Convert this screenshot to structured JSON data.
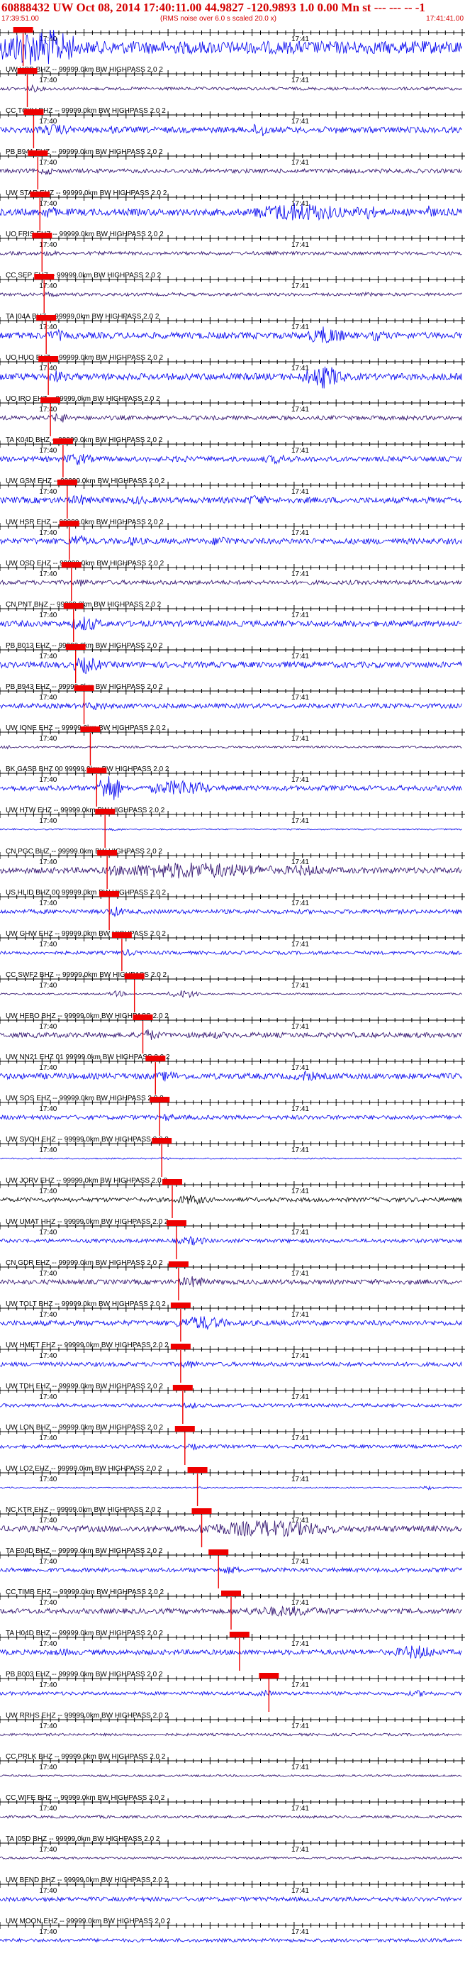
{
  "header": {
    "title": "60888432 UW Oct 08, 2014 17:40:11.00   44.9827 -120.9893  1.0 0.00 Mn st --- --- --   -1",
    "start_time": "17:39:51.00",
    "note": "(RMS noise over 6.0 s scaled 20.0 x)",
    "end_time": "17:41:41.00"
  },
  "chart_data": {
    "type": "line",
    "title": "60888432 UW Oct 08, 2014 17:40:11.00   44.9827 -120.9893  1.0 0.00 Mn st --- --- --   -1",
    "x_range_seconds": [
      0,
      110
    ],
    "tick_labels": [
      {
        "label": "17:40",
        "t": 9
      },
      {
        "label": "17:41",
        "t": 69
      }
    ],
    "colors": {
      "trace_blue": "#0000ee",
      "trace_dark": "#2a0a6a",
      "trace_black": "#000000",
      "pick": "#ee0000"
    },
    "channels": [
      {
        "label": "",
        "pick_t": 5.5,
        "amp": 0.75,
        "color": "#0000ee",
        "bursts": [
          [
            0,
            18,
            3.5
          ]
        ]
      },
      {
        "label": "UW YCB BHZ -- 99999.0km BW  HIGHPASS  2.0  2",
        "pick_t": 6.5,
        "amp": 0.18,
        "color": "#2a0a6a",
        "bursts": [
          [
            6,
            10,
            2.5
          ]
        ]
      },
      {
        "label": "CC TCKV BHZ -- 99999.0km BW  HIGHPASS  2.0  2",
        "pick_t": 8,
        "amp": 0.35,
        "color": "#0000ee",
        "bursts": [
          [
            8,
            18,
            2
          ],
          [
            24,
            30,
            1.5
          ],
          [
            60,
            64,
            3
          ],
          [
            78,
            82,
            1.5
          ]
        ]
      },
      {
        "label": "PB B941 EHZ -- 99999.0km BW  HIGHPASS  2.0  2",
        "pick_t": 9,
        "amp": 0.25,
        "color": "#2a0a6a",
        "bursts": [
          [
            9,
            13,
            2
          ],
          [
            50,
            55,
            1.3
          ]
        ]
      },
      {
        "label": "UW STAR EHZ -- 99999.0km BW  HIGHPASS  2.0  2",
        "pick_t": 9.5,
        "amp": 0.4,
        "color": "#0000ee",
        "bursts": [
          [
            9,
            14,
            2
          ],
          [
            60,
            82,
            3
          ],
          [
            84,
            90,
            2.5
          ],
          [
            100,
            104,
            2
          ]
        ]
      },
      {
        "label": "UO FRIS EHZ -- 99999.0km BW  HIGHPASS  2.0  2",
        "pick_t": 10,
        "amp": 0.2,
        "color": "#2a0a6a",
        "bursts": [
          [
            10,
            14,
            2
          ]
        ]
      },
      {
        "label": "CC SEP EHZ -- 99999.0km BW  HIGHPASS  2.0  2",
        "pick_t": 10.5,
        "amp": 0.18,
        "color": "#2a0a6a",
        "bursts": [
          [
            10,
            14,
            2
          ],
          [
            40,
            44,
            1.5
          ],
          [
            85,
            90,
            1.5
          ]
        ]
      },
      {
        "label": "TA I04A BHZ -- 99999.0km BW  HIGHPASS  2.0  2",
        "pick_t": 11,
        "amp": 0.38,
        "color": "#0000ee",
        "bursts": [
          [
            11,
            16,
            2
          ],
          [
            73,
            82,
            3
          ],
          [
            88,
            92,
            2
          ]
        ]
      },
      {
        "label": "UO HUO EHZ -- 99999.0km BW  HIGHPASS  2.0  2",
        "pick_t": 11.5,
        "amp": 0.4,
        "color": "#0000ee",
        "bursts": [
          [
            11,
            16,
            2
          ],
          [
            72,
            82,
            3.5
          ]
        ]
      },
      {
        "label": "UO IRO EHZ -- 99999.0km BW  HIGHPASS  2.0  2",
        "pick_t": 12,
        "amp": 0.25,
        "color": "#2a0a6a",
        "bursts": [
          [
            12,
            17,
            2.5
          ]
        ]
      },
      {
        "label": "TA K04D BHZ -- 99999.0km BW  HIGHPASS  2.0  2",
        "pick_t": 15,
        "amp": 0.3,
        "color": "#0000ee",
        "bursts": [
          [
            15,
            22,
            2.5
          ],
          [
            40,
            46,
            1.5
          ],
          [
            62,
            70,
            2
          ]
        ]
      },
      {
        "label": "UW GSM EHZ -- 99999.0km BW  HIGHPASS  2.0  2",
        "pick_t": 16,
        "amp": 0.35,
        "color": "#0000ee",
        "bursts": [
          [
            16,
            22,
            2
          ],
          [
            30,
            36,
            1.6
          ],
          [
            58,
            64,
            2
          ]
        ]
      },
      {
        "label": "UW HSR EHZ -- 99999.0km BW  HIGHPASS  2.0  2",
        "pick_t": 16.5,
        "amp": 0.35,
        "color": "#0000ee",
        "bursts": [
          [
            16,
            21,
            2.5
          ],
          [
            30,
            34,
            2
          ],
          [
            50,
            56,
            2
          ]
        ]
      },
      {
        "label": "UW OSD EHZ -- 99999.0km BW  HIGHPASS  2.0  2",
        "pick_t": 17,
        "amp": 0.25,
        "color": "#2a0a6a",
        "bursts": [
          [
            17,
            22,
            2
          ]
        ]
      },
      {
        "label": "CN PNT BHZ -- 99999.0km BW  HIGHPASS  2.0  2",
        "pick_t": 17.5,
        "amp": 0.35,
        "color": "#0000ee",
        "bursts": [
          [
            17,
            24,
            2.8
          ]
        ]
      },
      {
        "label": "PB B013 EHZ -- 99999.0km BW  HIGHPASS  2.0  2",
        "pick_t": 18,
        "amp": 0.35,
        "color": "#0000ee",
        "bursts": [
          [
            17,
            24,
            3
          ]
        ]
      },
      {
        "label": "PB B943 EHZ -- 99999.0km BW  HIGHPASS  2.0  2",
        "pick_t": 20,
        "amp": 0.28,
        "color": "#0000ee",
        "bursts": [
          [
            20,
            26,
            2
          ]
        ]
      },
      {
        "label": "UW IONE EHZ -- 99999.0km BW  HIGHPASS  2.0  2",
        "pick_t": 21.5,
        "amp": 0.12,
        "color": "#2a0a6a",
        "bursts": [
          [
            0,
            4,
            2
          ],
          [
            21,
            25,
            1.5
          ]
        ]
      },
      {
        "label": "BK GASB BHZ 00 99999.0km BW  HIGHPASS  2.0  2",
        "pick_t": 23,
        "amp": 0.3,
        "color": "#0000ee",
        "bursts": [
          [
            23,
            29,
            6
          ],
          [
            36,
            50,
            3.5
          ]
        ]
      },
      {
        "label": "UW HTW EHZ -- 99999.0km BW  HIGHPASS  2.0  2",
        "pick_t": 25,
        "amp": 0.08,
        "color": "#0000ee",
        "bursts": [
          [
            25,
            30,
            2
          ]
        ]
      },
      {
        "label": "CN PGC BHZ -- 99999.0km BW  HIGHPASS  2.0  2",
        "pick_t": 25.5,
        "amp": 0.35,
        "color": "#2a0a6a",
        "bursts": [
          [
            25,
            65,
            3
          ],
          [
            65,
            80,
            2
          ]
        ]
      },
      {
        "label": "US HLID BHZ 00 99999.0km BW  HIGHPASS  2.0  2",
        "pick_t": 26,
        "amp": 0.25,
        "color": "#0000ee",
        "bursts": [
          [
            25,
            30,
            2.5
          ]
        ]
      },
      {
        "label": "UW GHW EHZ -- 99999.0km BW  HIGHPASS  2.0  2",
        "pick_t": 29,
        "amp": 0.2,
        "color": "#0000ee",
        "bursts": [
          [
            28,
            33,
            2
          ]
        ]
      },
      {
        "label": "CC SWF2 BHZ -- 99999.0km BW  HIGHPASS  2.0  2",
        "pick_t": 32,
        "amp": 0.1,
        "color": "#2a0a6a",
        "bursts": [
          [
            26,
            30,
            4
          ],
          [
            40,
            48,
            5
          ]
        ]
      },
      {
        "label": "UW HEBO BHZ -- 99999.0km BW  HIGHPASS  2.0  2",
        "pick_t": 34,
        "amp": 0.3,
        "color": "#2a0a6a",
        "bursts": [
          [
            33,
            38,
            2.5
          ],
          [
            46,
            56,
            1.5
          ]
        ]
      },
      {
        "label": "UW NN21 EHZ 01 99999.0km BW  HIGHPASS  2.0  2",
        "pick_t": 37,
        "amp": 0.35,
        "color": "#0000ee",
        "bursts": [
          [
            37,
            43,
            2
          ],
          [
            70,
            76,
            2
          ]
        ]
      },
      {
        "label": "UW SOS EHZ -- 99999.0km BW  HIGHPASS  2.0  2",
        "pick_t": 38,
        "amp": 0.25,
        "color": "#0000ee",
        "bursts": [
          [
            38,
            42,
            2
          ]
        ]
      },
      {
        "label": "UW SVOH EHZ -- 99999.0km BW  HIGHPASS  2.0  2",
        "pick_t": 38.5,
        "amp": 0.08,
        "color": "#0000ee",
        "bursts": [
          [
            38,
            41,
            2
          ]
        ]
      },
      {
        "label": "UW JORV EHZ -- 99999.0km BW  HIGHPASS  2.0  2",
        "pick_t": 41,
        "amp": 0.25,
        "color": "#000000",
        "bursts": [
          [
            41,
            50,
            2.5
          ]
        ]
      },
      {
        "label": "UW UMAT HHZ -- 99999.0km BW  HIGHPASS  2.0  2",
        "pick_t": 42,
        "amp": 0.22,
        "color": "#0000ee",
        "bursts": [
          [
            42,
            50,
            2.5
          ]
        ]
      },
      {
        "label": "CN GDR EHZ -- 99999.0km BW  HIGHPASS  2.0  2",
        "pick_t": 42.5,
        "amp": 0.28,
        "color": "#2a0a6a",
        "bursts": [
          [
            42,
            50,
            2.5
          ]
        ]
      },
      {
        "label": "UW TOLT BHZ -- 99999.0km BW  HIGHPASS  2.0  2",
        "pick_t": 43,
        "amp": 0.3,
        "color": "#0000ee",
        "bursts": [
          [
            42,
            54,
            3
          ]
        ]
      },
      {
        "label": "UW HMET EHZ -- 99999.0km BW  HIGHPASS  2.0  2",
        "pick_t": 43,
        "amp": 0.25,
        "color": "#0000ee",
        "bursts": [
          [
            42,
            48,
            2
          ]
        ]
      },
      {
        "label": "UW TDH EHZ -- 99999.0km BW  HIGHPASS  2.0  2",
        "pick_t": 43.5,
        "amp": 0.2,
        "color": "#0000ee",
        "bursts": [
          [
            43,
            48,
            2
          ]
        ]
      },
      {
        "label": "UW LON BHZ -- 99999.0km BW  HIGHPASS  2.0  2",
        "pick_t": 44,
        "amp": 0.2,
        "color": "#0000ee",
        "bursts": [
          [
            44,
            48,
            2
          ]
        ]
      },
      {
        "label": "UW LO2 EHZ -- 99999.0km BW  HIGHPASS  2.0  2",
        "pick_t": 47,
        "amp": 0.08,
        "color": "#0000ee",
        "bursts": [
          [
            47,
            50,
            2
          ],
          [
            100,
            104,
            3
          ]
        ]
      },
      {
        "label": "NC KTR EHZ -- 99999.0km BW  HIGHPASS  2.0  2",
        "pick_t": 48,
        "amp": 0.35,
        "color": "#2a0a6a",
        "bursts": [
          [
            47,
            80,
            3
          ]
        ]
      },
      {
        "label": "TA E04D BHZ -- 99999.0km BW  HIGHPASS  2.0  2",
        "pick_t": 52,
        "amp": 0.25,
        "color": "#0000ee",
        "bursts": [
          [
            52,
            58,
            2
          ]
        ]
      },
      {
        "label": "CC TIMB EHZ -- 99999.0km BW  HIGHPASS  2.0  2",
        "pick_t": 55,
        "amp": 0.3,
        "color": "#2a0a6a",
        "bursts": [
          [
            55,
            80,
            2.2
          ]
        ]
      },
      {
        "label": "TA H04D BHZ -- 99999.0km BW  HIGHPASS  2.0  2",
        "pick_t": 57,
        "amp": 0.3,
        "color": "#0000ee",
        "bursts": [
          [
            10,
            20,
            1.5
          ],
          [
            94,
            104,
            3
          ]
        ]
      },
      {
        "label": "PB B003 EHZ -- 99999.0km BW  HIGHPASS  2.0  2",
        "pick_t": 64,
        "amp": 0.2,
        "color": "#0000ee",
        "bursts": [
          [
            60,
            66,
            2
          ],
          [
            96,
            104,
            2
          ]
        ]
      },
      {
        "label": "UW RRHS EHZ -- 99999.0km BW  HIGHPASS  2.0  2",
        "pick_t": 0,
        "amp": 0.15,
        "color": "#2a0a6a",
        "bursts": []
      },
      {
        "label": "CC PRLK BHZ -- 99999.0km BW  HIGHPASS  2.0  2",
        "pick_t": 0,
        "amp": 0.12,
        "color": "#2a0a6a",
        "bursts": []
      },
      {
        "label": "CC WIFE BHZ -- 99999.0km BW  HIGHPASS  2.0  2",
        "pick_t": 0,
        "amp": 0.15,
        "color": "#2a0a6a",
        "bursts": [
          [
            20,
            30,
            1.3
          ]
        ]
      },
      {
        "label": "TA I05D BHZ -- 99999.0km BW  HIGHPASS  2.0  2",
        "pick_t": 0,
        "amp": 0.12,
        "color": "#2a0a6a",
        "bursts": []
      },
      {
        "label": "UW BEND BHZ -- 99999.0km BW  HIGHPASS  2.0  2",
        "pick_t": 0,
        "amp": 0.25,
        "color": "#0000ee",
        "bursts": []
      },
      {
        "label": "UW MOON EHZ -- 99999.0km BW  HIGHPASS  2.0  2",
        "pick_t": 0,
        "amp": 0.2,
        "color": "#0000ee",
        "bursts": []
      }
    ]
  }
}
